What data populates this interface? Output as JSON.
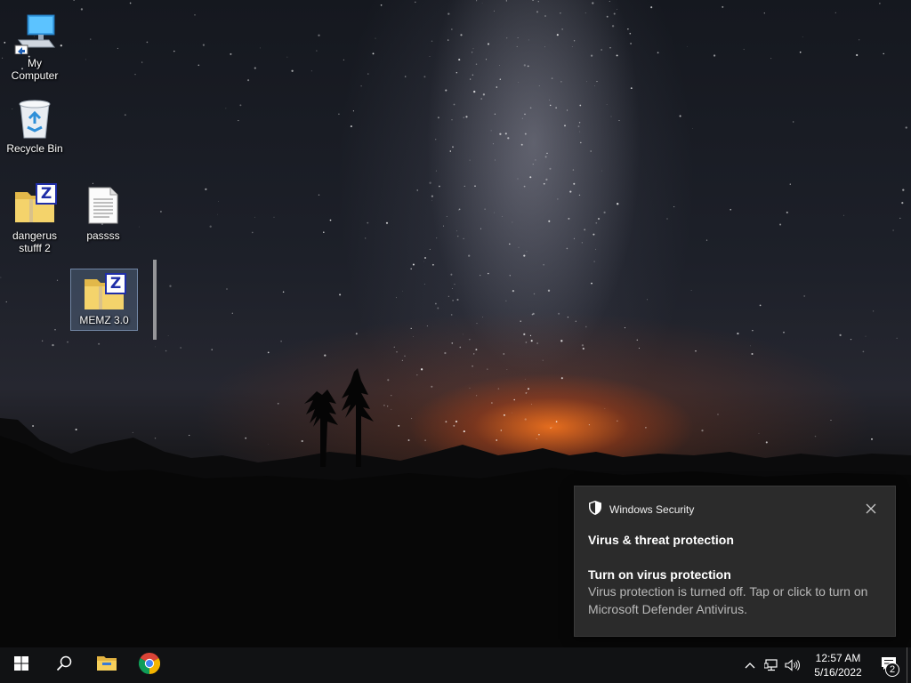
{
  "desktop": {
    "icons": [
      {
        "label": "My Computer",
        "icon": "computer-icon"
      },
      {
        "label": "Recycle Bin",
        "icon": "recycle-bin-icon"
      },
      {
        "label": "dangerus stufff 2",
        "icon": "zip-folder-icon"
      },
      {
        "label": "passss",
        "icon": "text-document-icon"
      },
      {
        "label": "MEMZ 3.0",
        "icon": "zip-folder-icon",
        "selected": true
      }
    ]
  },
  "toast": {
    "app_name": "Windows Security",
    "title": "Virus & threat protection",
    "subtitle": "Turn on virus protection",
    "body": "Virus protection is turned off. Tap or click to turn on Microsoft Defender Antivirus.",
    "zip_badge": "Z"
  },
  "taskbar": {
    "pinned": [
      "start-icon",
      "search-icon",
      "file-explorer-icon",
      "chrome-icon"
    ],
    "tray": [
      "chevron-up-icon",
      "network-icon",
      "volume-icon"
    ],
    "clock_time": "12:57 AM",
    "clock_date": "5/16/2022",
    "notification_count": "2"
  },
  "colors": {
    "taskbar": "#111214",
    "toast_bg": "#2b2b2b",
    "toast_body_text": "#b9b9b9",
    "zip_badge": "#1f2ea8",
    "folder": "#f4d36b"
  }
}
